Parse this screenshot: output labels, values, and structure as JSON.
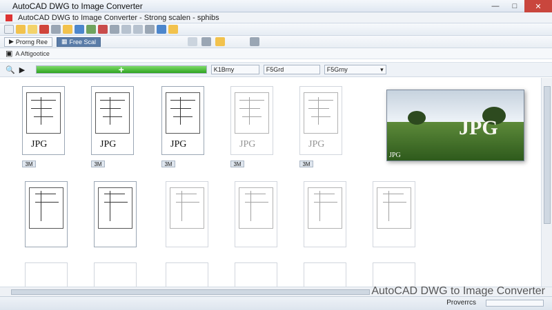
{
  "window": {
    "title": "AutoCAD DWG to Image Converter"
  },
  "document": {
    "title": "AutoCAD DWG to Image Converter - Strong  scalen - sphibs"
  },
  "toolbar2": {
    "tab1": "Prorng Ree",
    "tab2": "Free Scal"
  },
  "breadcrumb": {
    "path": "A Aftigootice"
  },
  "progress": {
    "value": 1.0,
    "field1": "K1Brny",
    "field2": "F5Grd",
    "field3": "F5Grny"
  },
  "thumbnails": {
    "row1": [
      {
        "label": "3M",
        "jpg": "JPG"
      },
      {
        "label": "3M",
        "jpg": "JPG"
      },
      {
        "label": "3M",
        "jpg": "JPG"
      },
      {
        "label": "3M",
        "jpg": "JPG"
      },
      {
        "label": "3M",
        "jpg": "JPG"
      }
    ]
  },
  "preview": {
    "big": "JPG",
    "tag": "JPG"
  },
  "status": {
    "right_text": "Proverrcs"
  },
  "watermark": "AutoCAD DWG to Image Converter"
}
